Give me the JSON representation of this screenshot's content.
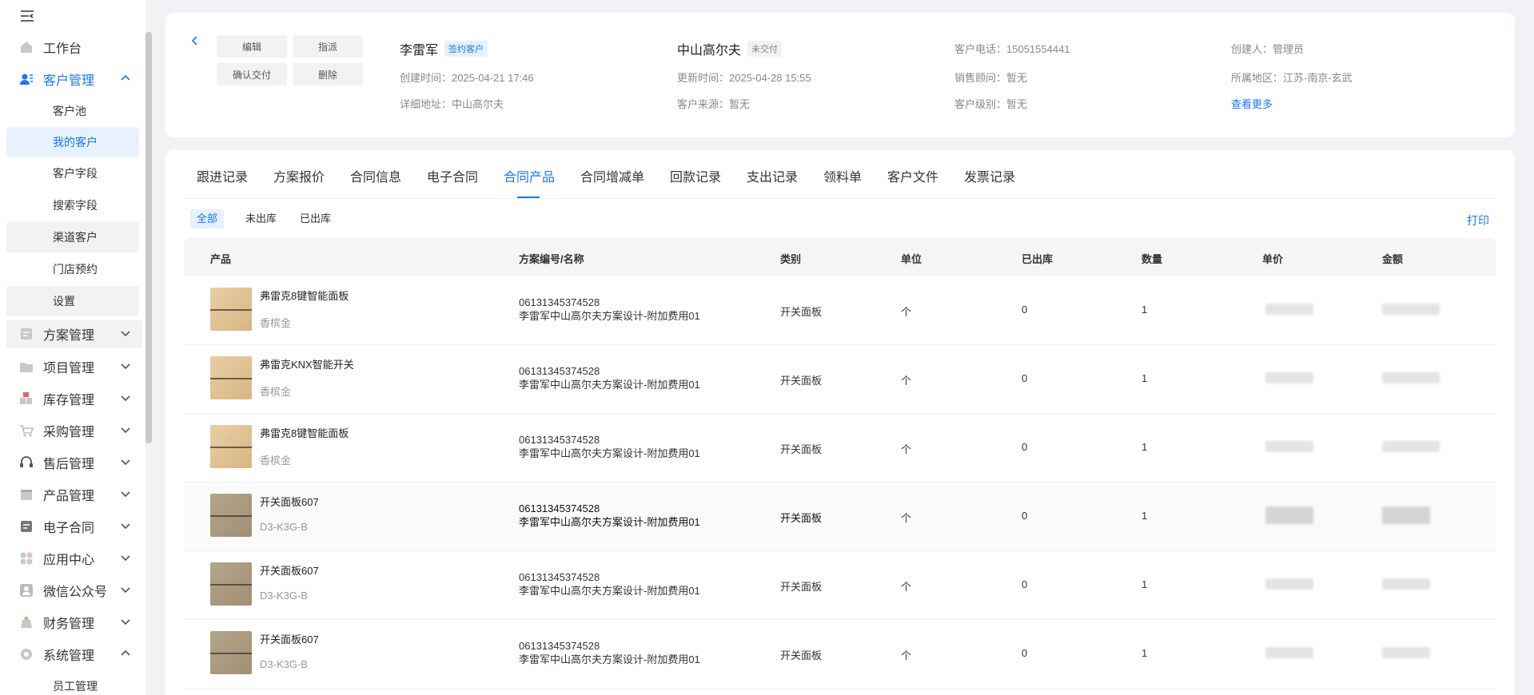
{
  "sidebar": {
    "toggle_icon": "menu-fold-icon",
    "items": [
      {
        "label": "工作台",
        "icon": "home-icon"
      },
      {
        "label": "客户管理",
        "icon": "customer-icon",
        "expanded": true,
        "children": [
          "客户池",
          "我的客户",
          "客户字段",
          "搜索字段",
          "渠道客户",
          "门店预约",
          "设置"
        ]
      },
      {
        "label": "方案管理",
        "icon": "plan-icon"
      },
      {
        "label": "项目管理",
        "icon": "folder-icon"
      },
      {
        "label": "库存管理",
        "icon": "inventory-icon"
      },
      {
        "label": "采购管理",
        "icon": "cart-icon"
      },
      {
        "label": "售后管理",
        "icon": "headset-icon"
      },
      {
        "label": "产品管理",
        "icon": "product-icon"
      },
      {
        "label": "电子合同",
        "icon": "contract-icon"
      },
      {
        "label": "应用中心",
        "icon": "apps-icon"
      },
      {
        "label": "微信公众号",
        "icon": "wechat-icon"
      },
      {
        "label": "财务管理",
        "icon": "finance-icon"
      },
      {
        "label": "系统管理",
        "icon": "settings-icon",
        "expanded": true,
        "children": [
          "员工管理"
        ]
      }
    ],
    "selected_child": "我的客户"
  },
  "header": {
    "buttons": [
      "编辑",
      "指派",
      "确认交付",
      "删除"
    ],
    "customer_name": "李雷军",
    "customer_tag": "签约客户",
    "created_time": "创建时间：2025-04-21 17:46",
    "address": "详细地址：中山高尔夫",
    "project_name": "中山高尔夫",
    "project_tag": "未交付",
    "updated_time": "更新时间：2025-04-28 15:55",
    "source": "客户来源：暂无",
    "phone": "客户电话：15051554441",
    "sales": "销售顾问：暂无",
    "level": "客户级别：暂无",
    "creator": "创建人：管理员",
    "region": "所属地区：江苏-南京-玄武",
    "more_link": "查看更多"
  },
  "tabs": [
    "跟进记录",
    "方案报价",
    "合同信息",
    "电子合同",
    "合同产品",
    "合同增减单",
    "回款记录",
    "支出记录",
    "领料单",
    "客户文件",
    "发票记录"
  ],
  "active_tab": "合同产品",
  "filters": [
    "全部",
    "未出库",
    "已出库"
  ],
  "active_filter": "全部",
  "print_label": "打印",
  "table": {
    "columns": [
      "产品",
      "方案编号/名称",
      "类别",
      "单位",
      "已出库",
      "数量",
      "单价",
      "金额"
    ],
    "rows": [
      {
        "name": "弗雷克8键智能面板",
        "spec": "香槟金",
        "code": "06131345374528",
        "plan": "李雷军中山高尔夫方案设计-附加费用01",
        "category": "开关面板",
        "unit": "个",
        "out": "0",
        "qty": "1",
        "thumb": "gold"
      },
      {
        "name": "弗雷克KNX智能开关",
        "spec": "香槟金",
        "code": "06131345374528",
        "plan": "李雷军中山高尔夫方案设计-附加费用01",
        "category": "开关面板",
        "unit": "个",
        "out": "0",
        "qty": "1",
        "thumb": "gold"
      },
      {
        "name": "弗雷克8键智能面板",
        "spec": "香槟金",
        "code": "06131345374528",
        "plan": "李雷军中山高尔夫方案设计-附加费用01",
        "category": "开关面板",
        "unit": "个",
        "out": "0",
        "qty": "1",
        "thumb": "gold"
      },
      {
        "name": "开关面板607",
        "spec": "D3-K3G-B",
        "code": "06131345374528",
        "plan": "李雷军中山高尔夫方案设计-附加费用01",
        "category": "开关面板",
        "unit": "个",
        "out": "0",
        "qty": "1",
        "thumb": "taupe"
      },
      {
        "name": "开关面板607",
        "spec": "D3-K3G-B",
        "code": "06131345374528",
        "plan": "李雷军中山高尔夫方案设计-附加费用01",
        "category": "开关面板",
        "unit": "个",
        "out": "0",
        "qty": "1",
        "thumb": "taupe"
      },
      {
        "name": "开关面板607",
        "spec": "D3-K3G-B",
        "code": "06131345374528",
        "plan": "李雷军中山高尔夫方案设计-附加费用01",
        "category": "开关面板",
        "unit": "个",
        "out": "0",
        "qty": "1",
        "thumb": "taupe"
      }
    ]
  },
  "colors": {
    "accent": "#1677ff",
    "background": "#f0f2f5"
  }
}
